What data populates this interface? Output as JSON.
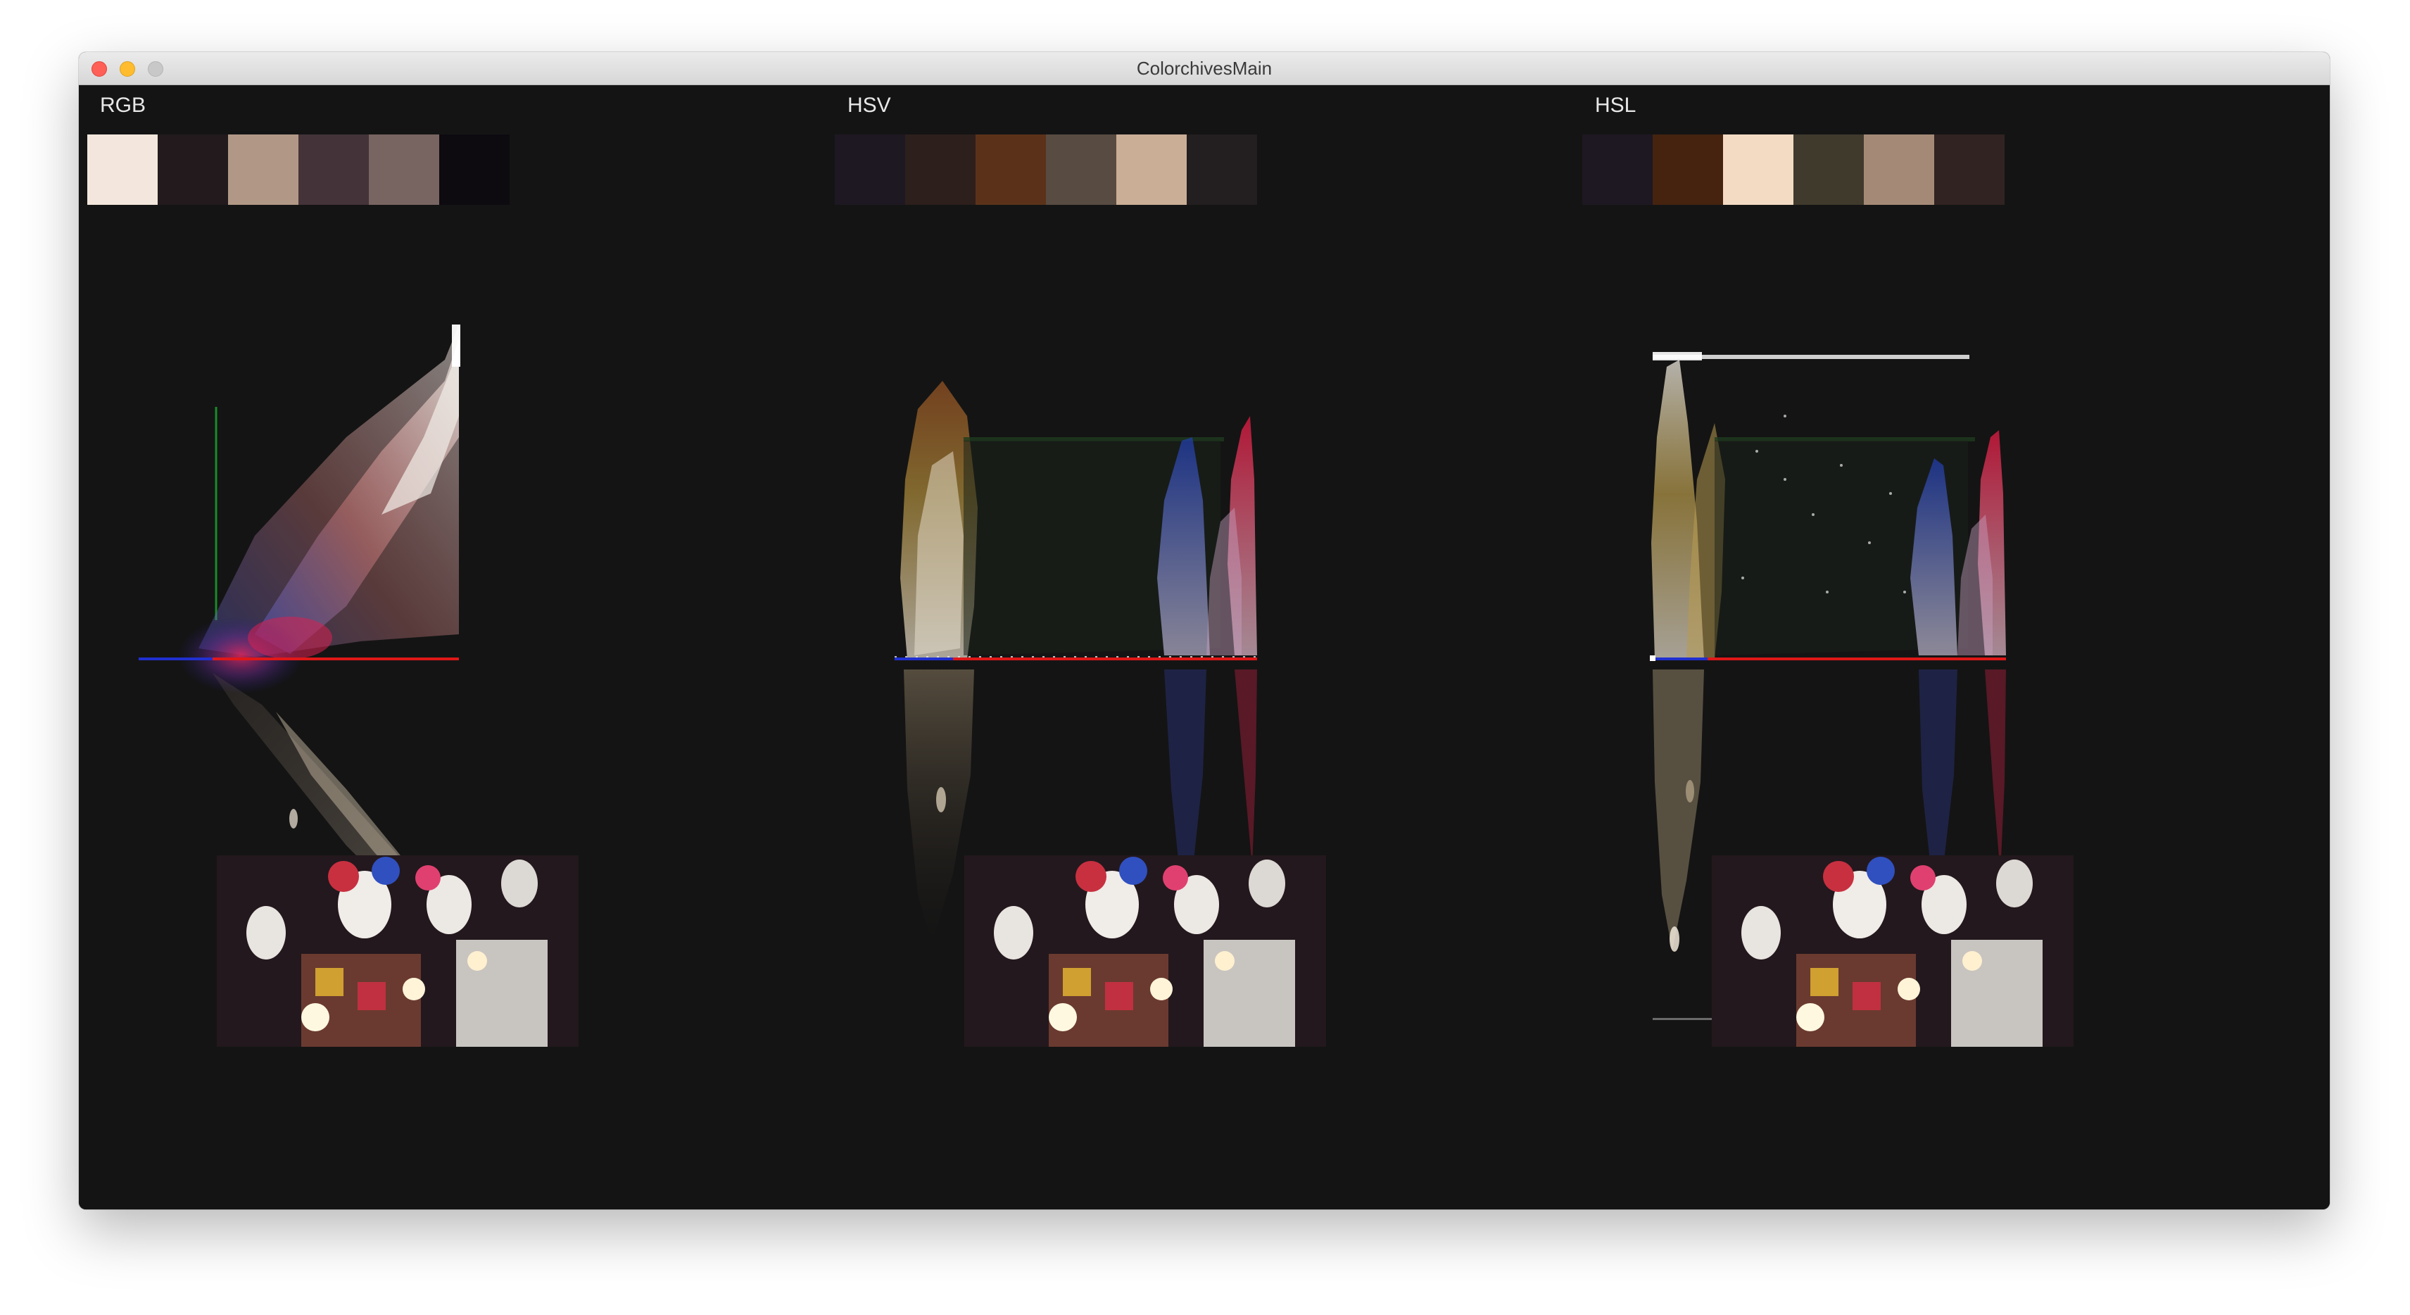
{
  "window": {
    "title": "ColorchivesMain"
  },
  "panels": [
    {
      "id": "rgb",
      "label": "RGB",
      "swatches": [
        "#f3e6dc",
        "#221a1d",
        "#b19886",
        "#443338",
        "#786461",
        "#0d0a10"
      ]
    },
    {
      "id": "hsv",
      "label": "HSV",
      "swatches": [
        "#1e1822",
        "#2d1f1c",
        "#5b3219",
        "#584c42",
        "#caae96",
        "#231e1f"
      ]
    },
    {
      "id": "hsl",
      "label": "HSL",
      "swatches": [
        "#1e1822",
        "#45230f",
        "#f3dbc3",
        "#3f3a2c",
        "#a48a76",
        "#302321"
      ]
    }
  ],
  "icons": {
    "close": "close-icon",
    "minimize": "minimize-icon",
    "zoom": "zoom-icon"
  },
  "colors": {
    "background": "#141414",
    "axis_red": "#e01818",
    "axis_blue": "#2030d0",
    "axis_green": "#1a8a2a"
  }
}
